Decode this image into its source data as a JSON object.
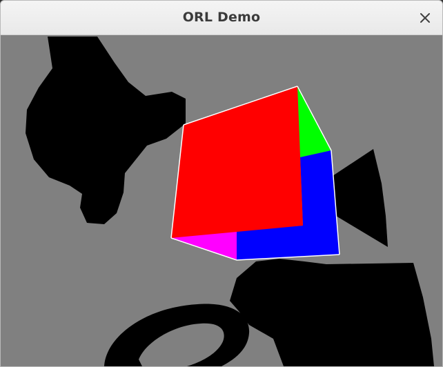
{
  "window": {
    "title": "ORL Demo",
    "close_icon": "close-icon"
  },
  "scene": {
    "background_color": "#808080",
    "shadow_color": "#000000",
    "cube_face_colors": {
      "front": "#ff0000",
      "top": "#00ff00",
      "right": "#0000ff",
      "bottom": "#ff00ff"
    },
    "edge_color": "#ffffff"
  }
}
